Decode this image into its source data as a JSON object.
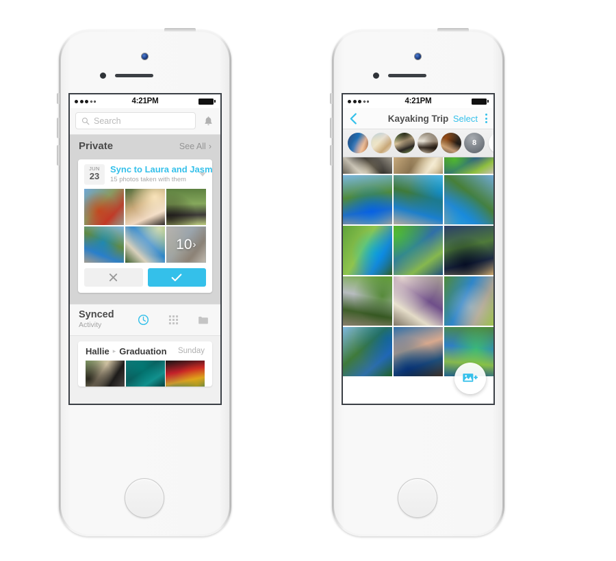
{
  "left_phone": {
    "status_bar": {
      "time": "4:21PM",
      "signal_filled": 3,
      "signal_empty": 2
    },
    "search": {
      "placeholder": "Search",
      "value": "",
      "icon": "search-icon"
    },
    "notifications_icon": "bell-icon",
    "private_section": {
      "title": "Private",
      "see_all_label": "See All",
      "chevron": "›"
    },
    "sync_card": {
      "date_month": "JUN",
      "date_day": "23",
      "title": "Sync to Laura and Jasmine?",
      "subtitle": "15 photos taken with them",
      "disclosure_icon": "caret-down-icon",
      "overflow_count": "10",
      "overflow_chevron": "›",
      "decline_icon": "close-icon",
      "accept_icon": "check-icon",
      "photos": [
        {
          "name": "riverbank-red-truck",
          "colors": [
            "#6fa8d8",
            "#8a9a62",
            "#b8432f",
            "#9b9384"
          ]
        },
        {
          "name": "two-women-portrait",
          "colors": [
            "#4d6b3a",
            "#c8a878",
            "#f0d8c0",
            "#2e2a26"
          ]
        },
        {
          "name": "man-at-river",
          "colors": [
            "#5c7f3f",
            "#86a85c",
            "#3d3a38",
            "#b9c97e"
          ]
        },
        {
          "name": "kayak-launch-bridge",
          "colors": [
            "#7fb4dd",
            "#5f8a44",
            "#2f7fc4",
            "#a39d92"
          ]
        },
        {
          "name": "two-kayakers-river",
          "colors": [
            "#6fa04a",
            "#2f86c9",
            "#d8d0bc",
            "#3b5f2e"
          ]
        },
        {
          "name": "more-photos-blurred",
          "colors": [
            "#b8b4ae",
            "#9aa4ac",
            "#8a8176",
            "#c4bdb2"
          ]
        }
      ]
    },
    "synced_section": {
      "title": "Synced",
      "subtitle": "Activity",
      "tabs": [
        {
          "name": "clock-icon",
          "label": "Activity",
          "active": true,
          "color": "#34c0ea"
        },
        {
          "name": "grid-icon",
          "label": "Grid",
          "active": false,
          "color": "#c4c4c4"
        },
        {
          "name": "album-icon",
          "label": "Albums",
          "active": false,
          "color": "#c4c4c4"
        }
      ]
    },
    "activity_item": {
      "user": "Hallie",
      "separator": "▸",
      "album": "Graduation",
      "when": "Sunday",
      "photos": [
        {
          "name": "graduation-cap",
          "colors": [
            "#8fae72",
            "#cdbfa0",
            "#1d1b1a",
            "#4a4542"
          ]
        },
        {
          "name": "teal-gown",
          "colors": [
            "#0d7a78",
            "#0a5f5e",
            "#12908d",
            "#083f3e"
          ]
        },
        {
          "name": "medal-ribbon",
          "colors": [
            "#141414",
            "#c4212a",
            "#c9972f",
            "#0c7a72"
          ]
        },
        {
          "name": "sky-clouds",
          "colors": [
            "#a9ccdf",
            "#dfe9ef",
            "#6d8f5b",
            "#c3d6e2"
          ]
        }
      ]
    }
  },
  "right_phone": {
    "status_bar": {
      "time": "4:21PM",
      "signal_filled": 3,
      "signal_empty": 2
    },
    "nav": {
      "back_icon": "chevron-left-icon",
      "title": "Kayaking Trip",
      "select_label": "Select",
      "menu_icon": "kebab-menu-icon"
    },
    "people": {
      "add_icon": "plus-icon",
      "extra_count": "8",
      "avatars": [
        {
          "name": "avatar-woman-blue",
          "colors": [
            "#2f4a7a",
            "#1b6fb5",
            "#d8a98e",
            "#3a2d26"
          ]
        },
        {
          "name": "avatar-woman-beach",
          "colors": [
            "#9fc6de",
            "#e4ddd2",
            "#c8a776",
            "#f0ece4"
          ]
        },
        {
          "name": "avatar-man-sunglasses",
          "colors": [
            "#3f6b33",
            "#d9c39c",
            "#2a2622",
            "#7f9a54"
          ]
        },
        {
          "name": "avatar-man-dog",
          "colors": [
            "#8a7f6e",
            "#e8e2d6",
            "#3b3026",
            "#b5a894"
          ]
        },
        {
          "name": "avatar-man-hat",
          "colors": [
            "#4a3c2e",
            "#1f1a16",
            "#c49a74",
            "#6a5a44"
          ]
        }
      ]
    },
    "grid_photos": [
      {
        "name": "gravel-truck-top",
        "colors": [
          "#9a9488",
          "#2f2c28",
          "#c2bcae",
          "#6a6458"
        ]
      },
      {
        "name": "tan-jacket-top",
        "colors": [
          "#c7a97c",
          "#8a7350",
          "#e0d2b8",
          "#5e4e36"
        ]
      },
      {
        "name": "crowd-river-top",
        "colors": [
          "#3f7a44",
          "#2d5a88",
          "#8fbf3f",
          "#c9c2b4"
        ]
      },
      {
        "name": "group-kayaks-bridge",
        "colors": [
          "#7cb8e0",
          "#4f8a3c",
          "#1f6fc4",
          "#a8a296"
        ]
      },
      {
        "name": "kayaks-shore-group",
        "colors": [
          "#79b4dd",
          "#3f7a3a",
          "#1f7fc9",
          "#b3ac9e"
        ]
      },
      {
        "name": "loading-kayaks",
        "colors": [
          "#6fa9d6",
          "#477f38",
          "#2f86c4",
          "#a59e90"
        ]
      },
      {
        "name": "green-bank-kayaker",
        "colors": [
          "#5fa33a",
          "#8fc44e",
          "#1f86c9",
          "#2f5e22"
        ]
      },
      {
        "name": "kayakers-downriver",
        "colors": [
          "#4f8a3a",
          "#2f6fa8",
          "#86b84e",
          "#1f4f7a"
        ]
      },
      {
        "name": "paddler-closeup",
        "colors": [
          "#2a3f6a",
          "#4f7a3a",
          "#1d2a44",
          "#c9a46a"
        ]
      },
      {
        "name": "couple-talking",
        "colors": [
          "#6fa83f",
          "#b8bcc0",
          "#3f5f2a",
          "#8a7f6e"
        ]
      },
      {
        "name": "women-on-blanket",
        "colors": [
          "#a9a194",
          "#6f4f8a",
          "#e4dcc8",
          "#7f7566"
        ]
      },
      {
        "name": "kayaks-gravel-bar",
        "colors": [
          "#4f8a3a",
          "#2f86c9",
          "#a9a294",
          "#9fc44e"
        ]
      },
      {
        "name": "river-paddlers-distance",
        "colors": [
          "#7fb8e0",
          "#3f7a3a",
          "#2f6fa8",
          "#1f5f2a"
        ]
      },
      {
        "name": "selfie-couple-kayak",
        "colors": [
          "#2f6fa8",
          "#d8a98e",
          "#1f4f7a",
          "#3a2d26"
        ]
      },
      {
        "name": "group-kayaks-river",
        "colors": [
          "#4f8a3a",
          "#2f7fc4",
          "#86b84e",
          "#1f5f8a"
        ]
      }
    ],
    "fab": {
      "icon": "add-photo-icon",
      "color": "#34c0ea"
    }
  },
  "theme": {
    "accent": "#34c0ea",
    "gray_text": "#a2a2a2",
    "dark_text": "#4a4a4a"
  }
}
